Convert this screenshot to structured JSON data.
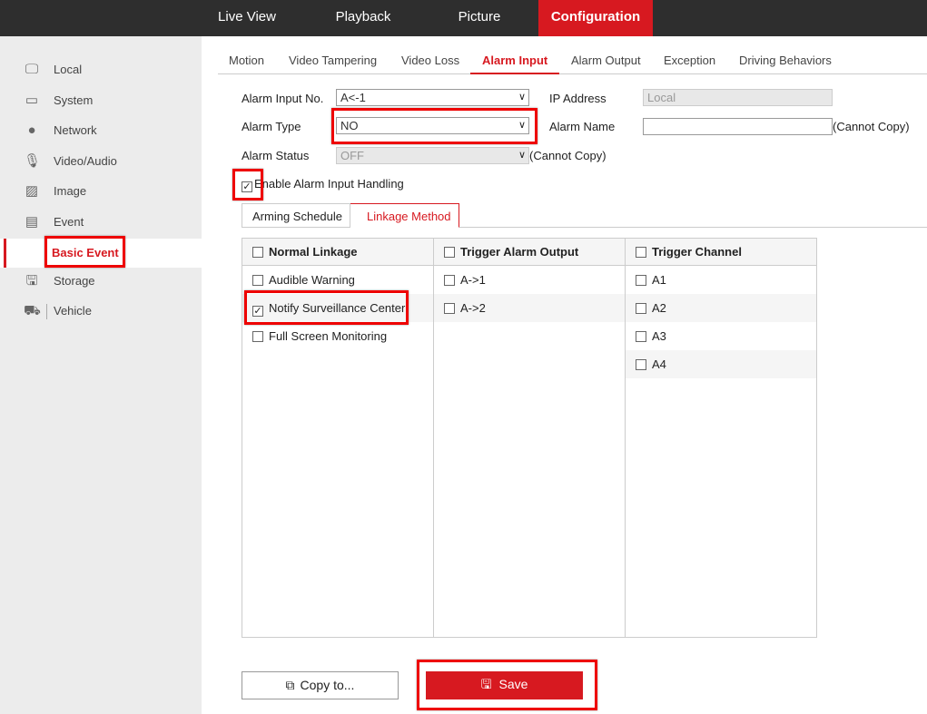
{
  "topnav": [
    "Live View",
    "Playback",
    "Picture",
    "Configuration"
  ],
  "sidebar": [
    "Local",
    "System",
    "Network",
    "Video/Audio",
    "Image",
    "Event",
    "Basic Event",
    "Storage",
    "Vehicle"
  ],
  "tabs": [
    "Motion",
    "Video Tampering",
    "Video Loss",
    "Alarm Input",
    "Alarm Output",
    "Exception",
    "Driving Behaviors"
  ],
  "form": {
    "alarm_input_no_label": "Alarm Input No.",
    "alarm_input_no": "A<-1",
    "ip_address_label": "IP Address",
    "ip_address": "Local",
    "alarm_type_label": "Alarm Type",
    "alarm_type": "NO",
    "alarm_name_label": "Alarm Name",
    "alarm_name": "",
    "cannot_copy": "(Cannot Copy)",
    "alarm_status_label": "Alarm Status",
    "alarm_status": "OFF",
    "enable_label": "Enable Alarm Input Handling",
    "enable_checked": true
  },
  "subtabs": [
    "Arming Schedule",
    "Linkage Method"
  ],
  "columns": [
    {
      "header": "Normal Linkage",
      "items": [
        {
          "label": "Audible Warning",
          "checked": false
        },
        {
          "label": "Notify Surveillance Center",
          "checked": true
        },
        {
          "label": "Full Screen Monitoring",
          "checked": false
        }
      ]
    },
    {
      "header": "Trigger Alarm Output",
      "items": [
        {
          "label": "A->1",
          "checked": false
        },
        {
          "label": "A->2",
          "checked": false
        }
      ]
    },
    {
      "header": "Trigger Channel",
      "items": [
        {
          "label": "A1",
          "checked": false
        },
        {
          "label": "A2",
          "checked": false
        },
        {
          "label": "A3",
          "checked": false
        },
        {
          "label": "A4",
          "checked": false
        }
      ]
    }
  ],
  "buttons": {
    "copy": "Copy to...",
    "save": "Save"
  },
  "colors": {
    "accent": "#d71920",
    "topbar": "#2e2e2e",
    "highlight": "#ee0000"
  }
}
